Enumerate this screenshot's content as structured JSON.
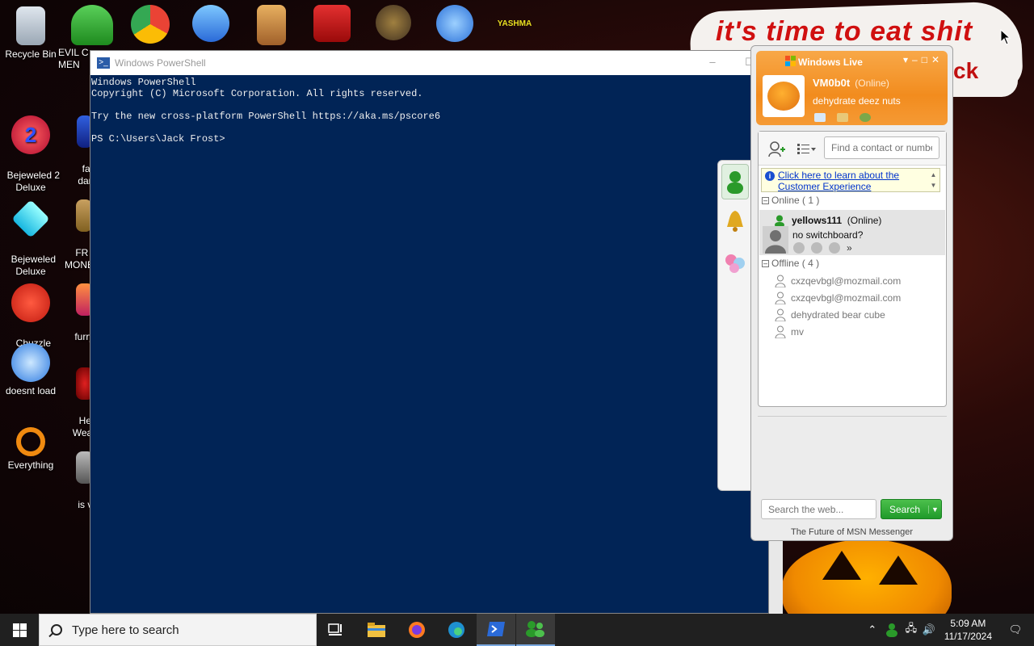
{
  "desktop": {
    "icons": [
      {
        "label": "Recycle Bin"
      },
      {
        "label": "Bejeweled 2\nDeluxe"
      },
      {
        "label": "Bejeweled\nDeluxe"
      },
      {
        "label": "Chuzzle\nDeluxe"
      },
      {
        "label": "doesnt load"
      },
      {
        "label": "Everything"
      }
    ],
    "partial_icons": [
      {
        "label": "EVIL C\nMEN"
      },
      {
        "label": "fat\ndar"
      },
      {
        "label": "FR\nMONE"
      },
      {
        "label": "furry"
      },
      {
        "label": "He\nWea"
      },
      {
        "label": "is v"
      }
    ],
    "top_icon_text": "YASHMA",
    "wallpaper_text": "it's time to eat shit",
    "wallpaper_text2": "ck"
  },
  "powershell": {
    "title": "Windows PowerShell",
    "lines": "Windows PowerShell\nCopyright (C) Microsoft Corporation. All rights reserved.\n\nTry the new cross-platform PowerShell https://aka.ms/pscore6\n\nPS C:\\Users\\Jack Frost>",
    "controls": {
      "minimize": "–",
      "maximize": "☐"
    }
  },
  "msn": {
    "title": "Windows Live",
    "user_name": "VM0b0t",
    "user_status": "(Online)",
    "personal_message": "dehydrate deez nuts",
    "find_placeholder": "Find a contact or number",
    "info_line1": "Click here to learn about the",
    "info_line2": "Customer Experience",
    "online_group": "Online ( 1 )",
    "offline_group": "Offline ( 4 )",
    "online_contact": {
      "name": "yellows111",
      "status": "(Online)",
      "message": "no switchboard?"
    },
    "offline_contacts": [
      "cxzqevbgl@mozmail.com",
      "cxzqevbgl@mozmail.com",
      "dehydrated bear cube",
      "mv"
    ],
    "web_search_placeholder": "Search the web...",
    "search_button": "Search",
    "footer": "The Future of MSN Messenger",
    "colors": {
      "header": "#f28c1e",
      "search_button": "#1f9a2a",
      "link": "#0033cc"
    }
  },
  "taskbar": {
    "search_placeholder": "Type here to search",
    "time": "5:09 AM",
    "date": "11/17/2024"
  }
}
